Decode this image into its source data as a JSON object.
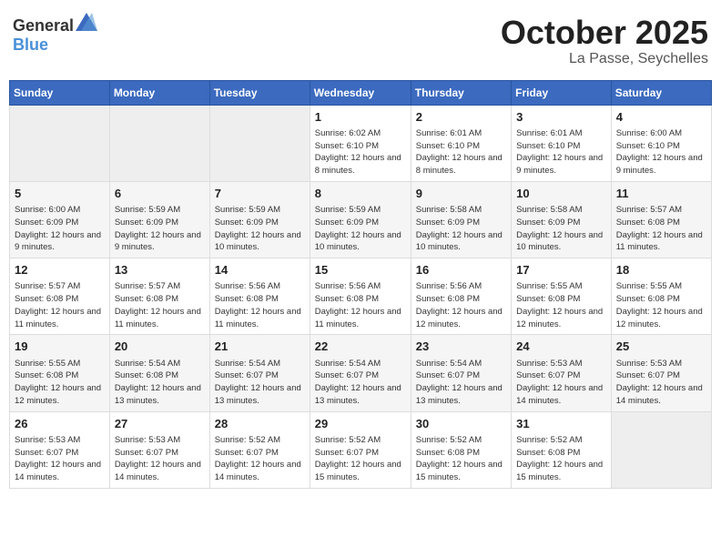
{
  "header": {
    "logo_general": "General",
    "logo_blue": "Blue",
    "month": "October 2025",
    "location": "La Passe, Seychelles"
  },
  "days_of_week": [
    "Sunday",
    "Monday",
    "Tuesday",
    "Wednesday",
    "Thursday",
    "Friday",
    "Saturday"
  ],
  "weeks": [
    [
      {
        "day": "",
        "info": ""
      },
      {
        "day": "",
        "info": ""
      },
      {
        "day": "",
        "info": ""
      },
      {
        "day": "1",
        "info": "Sunrise: 6:02 AM\nSunset: 6:10 PM\nDaylight: 12 hours and 8 minutes."
      },
      {
        "day": "2",
        "info": "Sunrise: 6:01 AM\nSunset: 6:10 PM\nDaylight: 12 hours and 8 minutes."
      },
      {
        "day": "3",
        "info": "Sunrise: 6:01 AM\nSunset: 6:10 PM\nDaylight: 12 hours and 9 minutes."
      },
      {
        "day": "4",
        "info": "Sunrise: 6:00 AM\nSunset: 6:10 PM\nDaylight: 12 hours and 9 minutes."
      }
    ],
    [
      {
        "day": "5",
        "info": "Sunrise: 6:00 AM\nSunset: 6:09 PM\nDaylight: 12 hours and 9 minutes."
      },
      {
        "day": "6",
        "info": "Sunrise: 5:59 AM\nSunset: 6:09 PM\nDaylight: 12 hours and 9 minutes."
      },
      {
        "day": "7",
        "info": "Sunrise: 5:59 AM\nSunset: 6:09 PM\nDaylight: 12 hours and 10 minutes."
      },
      {
        "day": "8",
        "info": "Sunrise: 5:59 AM\nSunset: 6:09 PM\nDaylight: 12 hours and 10 minutes."
      },
      {
        "day": "9",
        "info": "Sunrise: 5:58 AM\nSunset: 6:09 PM\nDaylight: 12 hours and 10 minutes."
      },
      {
        "day": "10",
        "info": "Sunrise: 5:58 AM\nSunset: 6:09 PM\nDaylight: 12 hours and 10 minutes."
      },
      {
        "day": "11",
        "info": "Sunrise: 5:57 AM\nSunset: 6:08 PM\nDaylight: 12 hours and 11 minutes."
      }
    ],
    [
      {
        "day": "12",
        "info": "Sunrise: 5:57 AM\nSunset: 6:08 PM\nDaylight: 12 hours and 11 minutes."
      },
      {
        "day": "13",
        "info": "Sunrise: 5:57 AM\nSunset: 6:08 PM\nDaylight: 12 hours and 11 minutes."
      },
      {
        "day": "14",
        "info": "Sunrise: 5:56 AM\nSunset: 6:08 PM\nDaylight: 12 hours and 11 minutes."
      },
      {
        "day": "15",
        "info": "Sunrise: 5:56 AM\nSunset: 6:08 PM\nDaylight: 12 hours and 11 minutes."
      },
      {
        "day": "16",
        "info": "Sunrise: 5:56 AM\nSunset: 6:08 PM\nDaylight: 12 hours and 12 minutes."
      },
      {
        "day": "17",
        "info": "Sunrise: 5:55 AM\nSunset: 6:08 PM\nDaylight: 12 hours and 12 minutes."
      },
      {
        "day": "18",
        "info": "Sunrise: 5:55 AM\nSunset: 6:08 PM\nDaylight: 12 hours and 12 minutes."
      }
    ],
    [
      {
        "day": "19",
        "info": "Sunrise: 5:55 AM\nSunset: 6:08 PM\nDaylight: 12 hours and 12 minutes."
      },
      {
        "day": "20",
        "info": "Sunrise: 5:54 AM\nSunset: 6:08 PM\nDaylight: 12 hours and 13 minutes."
      },
      {
        "day": "21",
        "info": "Sunrise: 5:54 AM\nSunset: 6:07 PM\nDaylight: 12 hours and 13 minutes."
      },
      {
        "day": "22",
        "info": "Sunrise: 5:54 AM\nSunset: 6:07 PM\nDaylight: 12 hours and 13 minutes."
      },
      {
        "day": "23",
        "info": "Sunrise: 5:54 AM\nSunset: 6:07 PM\nDaylight: 12 hours and 13 minutes."
      },
      {
        "day": "24",
        "info": "Sunrise: 5:53 AM\nSunset: 6:07 PM\nDaylight: 12 hours and 14 minutes."
      },
      {
        "day": "25",
        "info": "Sunrise: 5:53 AM\nSunset: 6:07 PM\nDaylight: 12 hours and 14 minutes."
      }
    ],
    [
      {
        "day": "26",
        "info": "Sunrise: 5:53 AM\nSunset: 6:07 PM\nDaylight: 12 hours and 14 minutes."
      },
      {
        "day": "27",
        "info": "Sunrise: 5:53 AM\nSunset: 6:07 PM\nDaylight: 12 hours and 14 minutes."
      },
      {
        "day": "28",
        "info": "Sunrise: 5:52 AM\nSunset: 6:07 PM\nDaylight: 12 hours and 14 minutes."
      },
      {
        "day": "29",
        "info": "Sunrise: 5:52 AM\nSunset: 6:07 PM\nDaylight: 12 hours and 15 minutes."
      },
      {
        "day": "30",
        "info": "Sunrise: 5:52 AM\nSunset: 6:08 PM\nDaylight: 12 hours and 15 minutes."
      },
      {
        "day": "31",
        "info": "Sunrise: 5:52 AM\nSunset: 6:08 PM\nDaylight: 12 hours and 15 minutes."
      },
      {
        "day": "",
        "info": ""
      }
    ]
  ]
}
